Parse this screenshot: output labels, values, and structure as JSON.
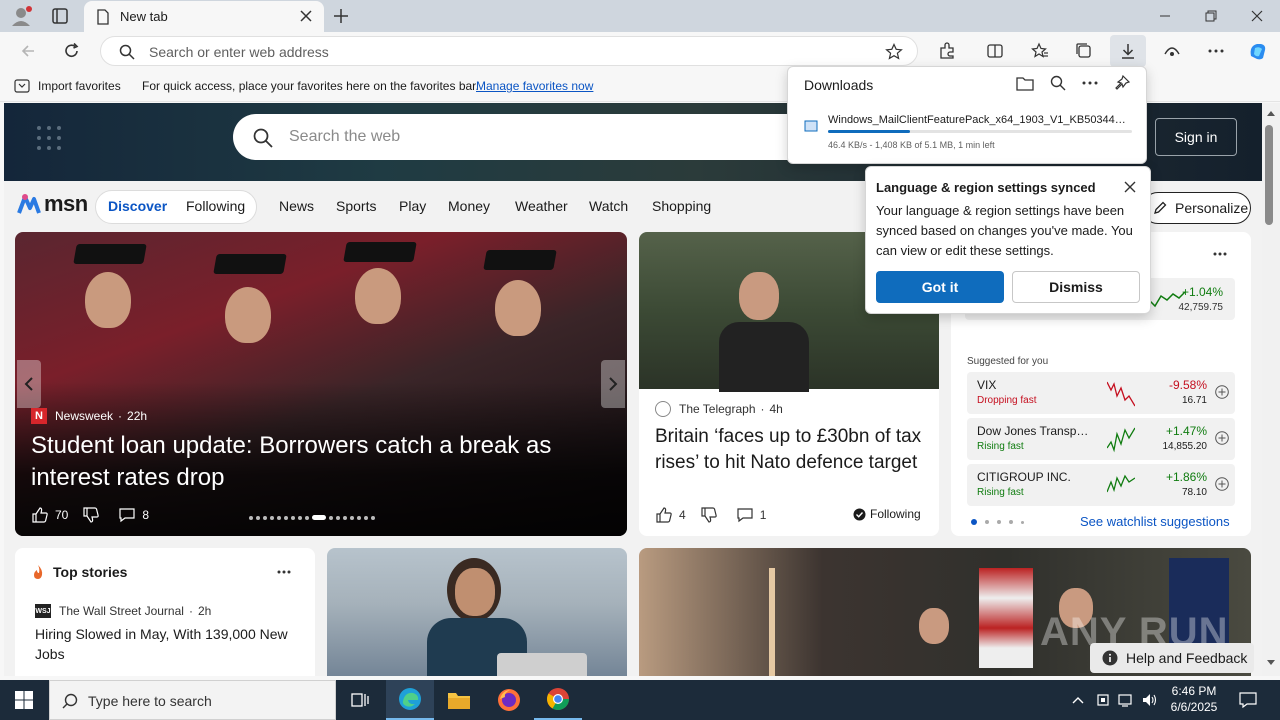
{
  "browser": {
    "tab_title": "New tab",
    "address_placeholder": "Search or enter web address"
  },
  "favorites_bar": {
    "import_label": "Import favorites",
    "hint_text": "For quick access, place your favorites here on the favorites bar.",
    "manage_link": "Manage favorites now"
  },
  "msn": {
    "search_placeholder": "Search the web",
    "sign_in": "Sign in",
    "logo_text": "msn",
    "nav": [
      "Discover",
      "Following",
      "News",
      "Sports",
      "Play",
      "Money",
      "Weather",
      "Watch",
      "Shopping"
    ],
    "personalize": "Personalize"
  },
  "main_story": {
    "source": "Newsweek",
    "age": "22h",
    "headline": "Student loan update: Borrowers catch a break as interest rates drop",
    "likes": "70",
    "comments": "8"
  },
  "telegraph_story": {
    "source": "The Telegraph",
    "age": "4h",
    "headline": "Britain ‘faces up to £30bn of tax rises’ to hit Nato defence target",
    "likes": "4",
    "comments": "1",
    "following": "Following"
  },
  "markets": {
    "top_change": "+1.04%",
    "top_value": "42,759.75",
    "suggested_label": "Suggested for you",
    "stocks": [
      {
        "name": "VIX",
        "trend": "Dropping fast",
        "change": "-9.58%",
        "value": "16.71",
        "color": "#c50f1f"
      },
      {
        "name": "Dow Jones Transp…",
        "trend": "Rising fast",
        "change": "+1.47%",
        "value": "14,855.20",
        "color": "#107c10"
      },
      {
        "name": "CITIGROUP INC.",
        "trend": "Rising fast",
        "change": "+1.86%",
        "value": "78.10",
        "color": "#107c10"
      }
    ],
    "watchlist_link": "See watchlist suggestions"
  },
  "top_stories": {
    "title": "Top stories",
    "source": "The Wall Street Journal",
    "age": "2h",
    "headline": "Hiring Slowed in May, With 139,000 New Jobs"
  },
  "downloads": {
    "title": "Downloads",
    "file_name": "Windows_MailClientFeaturePack_x64_1903_V1_KB50344…",
    "status": "46.4 KB/s - 1,408 KB of 5.1 MB, 1 min left",
    "progress": 0.27
  },
  "sync_popup": {
    "title": "Language & region settings synced",
    "body": "Your language & region settings have been synced based on changes you've made. You can view or edit these settings.",
    "got_it": "Got it",
    "dismiss": "Dismiss"
  },
  "help_button": "Help and Feedback",
  "watermark": "ANY RUN",
  "taskbar": {
    "search_placeholder": "Type here to search",
    "time": "6:46 PM",
    "date": "6/6/2025"
  },
  "colors": {
    "accent": "#0f6cbd",
    "link": "#0b55c4",
    "taskbar": "#1c2b3a"
  }
}
